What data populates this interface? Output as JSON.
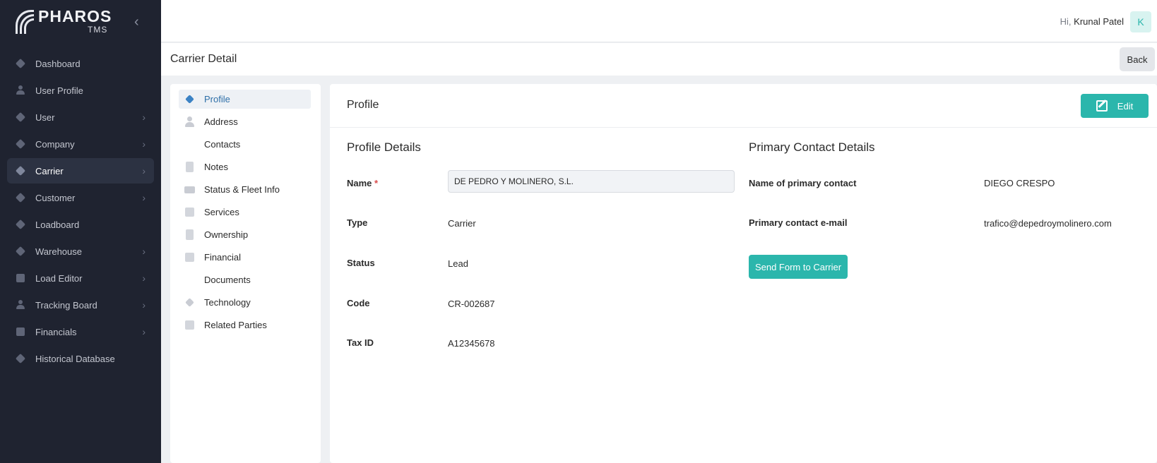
{
  "app": {
    "logo_title": "PHAROS",
    "logo_sub": "TMS"
  },
  "sidebar": {
    "items": [
      {
        "label": "Dashboard",
        "icon": "diamond-icon",
        "has_submenu": false,
        "active": false
      },
      {
        "label": "User Profile",
        "icon": "user-group-icon",
        "has_submenu": false,
        "active": false
      },
      {
        "label": "User",
        "icon": "diamond-icon",
        "has_submenu": true,
        "active": false
      },
      {
        "label": "Company",
        "icon": "diamond-icon",
        "has_submenu": true,
        "active": false
      },
      {
        "label": "Carrier",
        "icon": "diamond-icon",
        "has_submenu": true,
        "active": true
      },
      {
        "label": "Customer",
        "icon": "diamond-icon",
        "has_submenu": true,
        "active": false
      },
      {
        "label": "Loadboard",
        "icon": "diamond-icon",
        "has_submenu": false,
        "active": false
      },
      {
        "label": "Warehouse",
        "icon": "diamond-icon",
        "has_submenu": true,
        "active": false
      },
      {
        "label": "Load Editor",
        "icon": "box-icon",
        "has_submenu": true,
        "active": false
      },
      {
        "label": "Tracking Board",
        "icon": "person-icon",
        "has_submenu": true,
        "active": false
      },
      {
        "label": "Financials",
        "icon": "calculator-icon",
        "has_submenu": true,
        "active": false
      },
      {
        "label": "Historical Database",
        "icon": "diamond-icon",
        "has_submenu": false,
        "active": false
      }
    ]
  },
  "header": {
    "greeting_prefix": "Hi,",
    "user_name": "Krunal Patel",
    "avatar_initial": "K"
  },
  "subheader": {
    "title": "Carrier Detail",
    "back_label": "Back"
  },
  "subnav": {
    "items": [
      {
        "label": "Profile",
        "icon": "diamond-icon",
        "active": true
      },
      {
        "label": "Address",
        "icon": "person-icon",
        "active": false
      },
      {
        "label": "Contacts",
        "icon": "contacts-icon",
        "active": false
      },
      {
        "label": "Notes",
        "icon": "note-icon",
        "active": false
      },
      {
        "label": "Status & Fleet Info",
        "icon": "envelope-icon",
        "active": false
      },
      {
        "label": "Services",
        "icon": "card-icon",
        "active": false
      },
      {
        "label": "Ownership",
        "icon": "document-icon",
        "active": false
      },
      {
        "label": "Financial",
        "icon": "money-icon",
        "active": false
      },
      {
        "label": "Documents",
        "icon": "documents-icon",
        "active": false
      },
      {
        "label": "Technology",
        "icon": "diamond-icon",
        "active": false
      },
      {
        "label": "Related Parties",
        "icon": "card-icon",
        "active": false
      }
    ]
  },
  "card": {
    "title": "Profile",
    "edit_label": "Edit",
    "profile_details": {
      "title": "Profile Details",
      "name_label": "Name",
      "name_required": "*",
      "name_value": "DE PEDRO Y MOLINERO, S.L.",
      "type_label": "Type",
      "type_value": "Carrier",
      "status_label": "Status",
      "status_value": "Lead",
      "code_label": "Code",
      "code_value": "CR-002687",
      "taxid_label": "Tax ID",
      "taxid_value": "A12345678"
    },
    "primary_contact": {
      "title": "Primary Contact Details",
      "name_label": "Name of primary contact",
      "name_value": "DIEGO CRESPO",
      "email_label": "Primary contact e-mail",
      "email_value": "trafico@depedroymolinero.com",
      "send_form_label": "Send Form to Carrier"
    }
  },
  "colors": {
    "sidebar_bg": "#1f2330",
    "accent_teal": "#2bb6ac",
    "active_blue": "#2e6fa8",
    "required_red": "#d94c4c"
  }
}
